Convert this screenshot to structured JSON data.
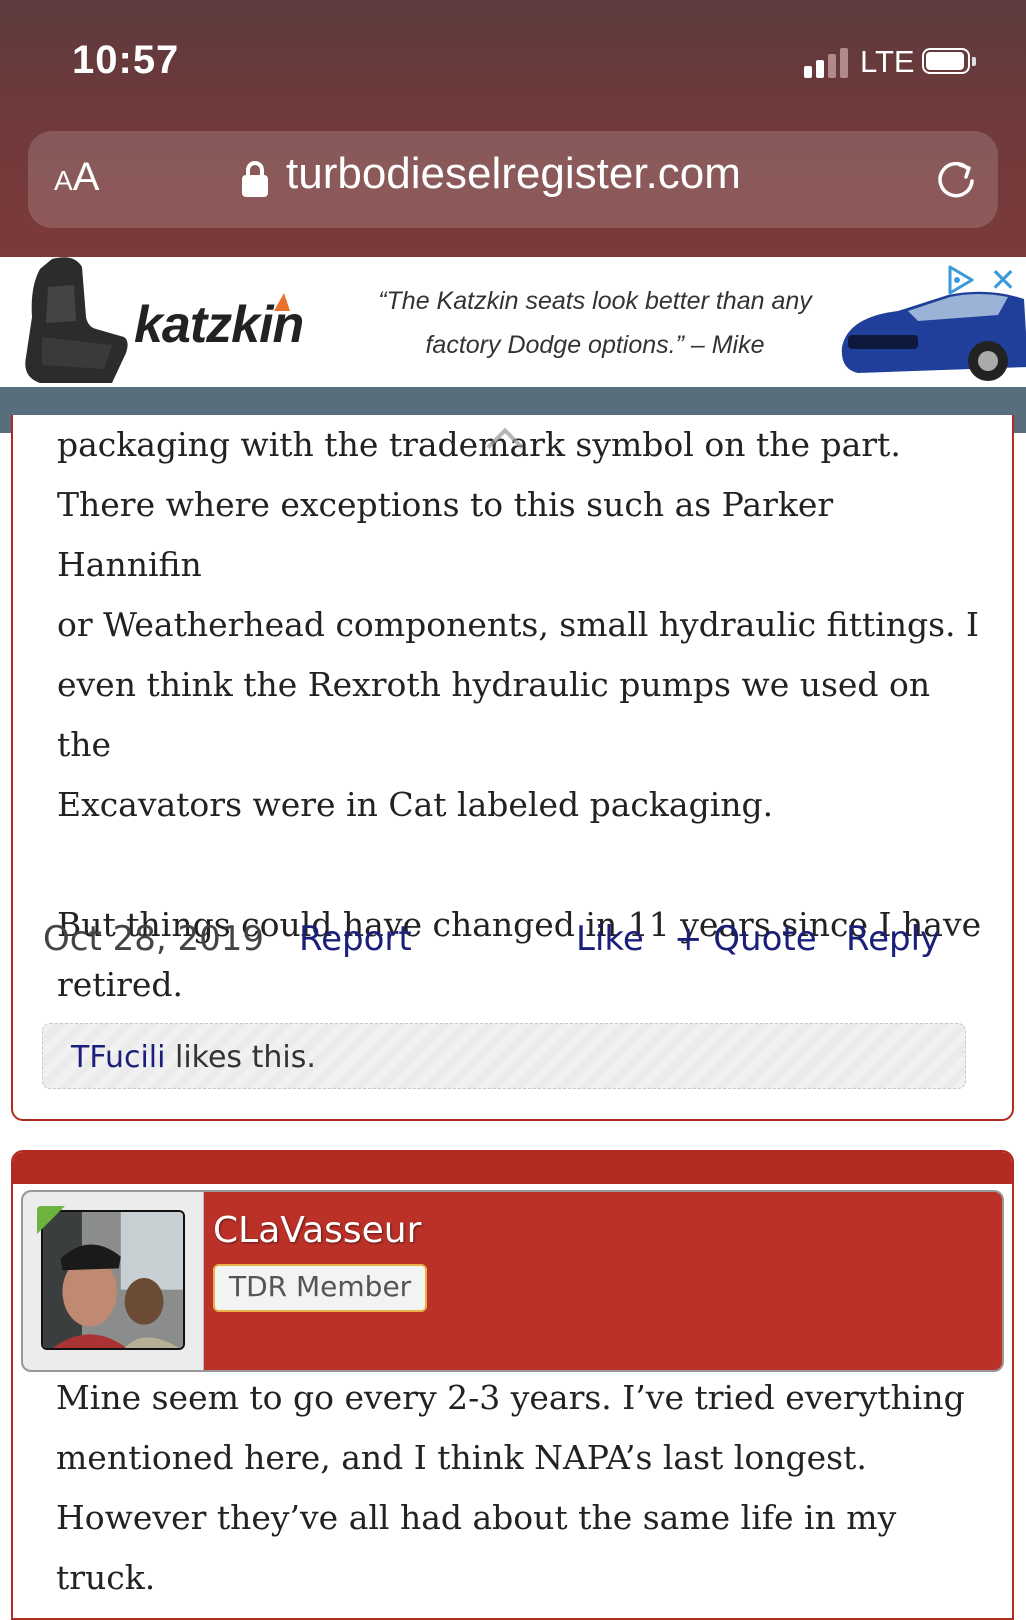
{
  "status_bar": {
    "time": "10:57",
    "network": "LTE"
  },
  "browser": {
    "text_size_small": "A",
    "text_size_large": "A",
    "domain": "turbodieselregister.com"
  },
  "ad": {
    "brand": "katzkin",
    "quote_line1": "“The Katzkin seats look better than any",
    "quote_line2": "factory Dodge options.”  – Mike"
  },
  "post1": {
    "lines": [
      "packaging with the trademark symbol on the part.",
      "There where exceptions to this such as Parker Hannifin",
      "or Weatherhead components, small hydraulic fittings. I",
      "even think the Rexroth hydraulic pumps we used on the",
      "Excavators were in Cat labeled packaging."
    ],
    "lines2": [
      "But things could have changed in 11 years since I have",
      "retired."
    ],
    "date": "Oct 28, 2019",
    "report": "Report",
    "like": "Like",
    "quote": "+ Quote",
    "reply": "Reply",
    "liked_by": "TFucili",
    "likes_suffix": " likes this."
  },
  "post2": {
    "username": "CLaVasseur",
    "member_title": "TDR Member",
    "lines": [
      "Mine seem to go every 2-3 years. I’ve tried everything",
      "mentioned here, and I think NAPA’s last longest.",
      "However they’ve all had about the same life in my",
      "truck."
    ]
  },
  "colors": {
    "accent_red": "#b32a22",
    "link_blue": "#1a1f7a",
    "badge_border": "#e8b24a"
  }
}
